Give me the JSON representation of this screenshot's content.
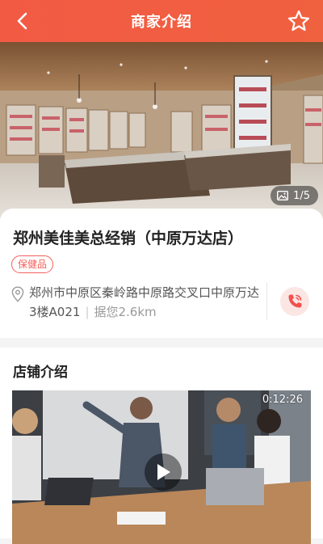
{
  "header": {
    "title": "商家介绍",
    "back_icon": "back-arrow-icon",
    "favorite_icon": "star-icon",
    "color": "#f25a44"
  },
  "gallery": {
    "counter": "1/5",
    "counter_icon": "image-icon"
  },
  "store": {
    "name": "郑州美佳美总经销（中原万达店）",
    "tag": "保健品",
    "address": "郑州市中原区秦岭路中原路交叉口中原万达3楼A021",
    "distance": "据您2.6km",
    "location_icon": "location-pin-icon",
    "phone_icon": "phone-icon"
  },
  "intro": {
    "title": "店铺介绍",
    "video_duration": "0:12:26",
    "play_icon": "play-icon"
  }
}
